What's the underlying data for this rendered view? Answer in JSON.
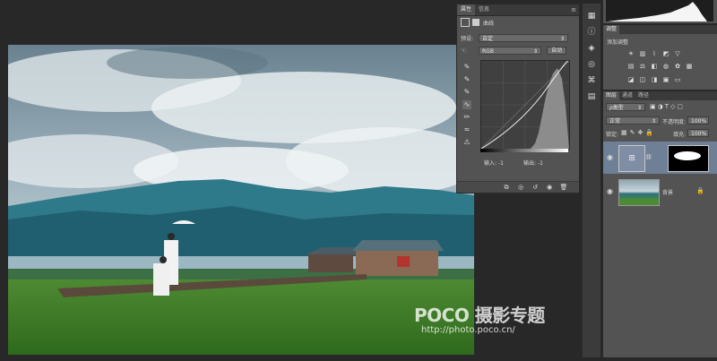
{
  "watermark": {
    "logo": "POCO 摄影专题",
    "url": "http://photo.poco.cn/"
  },
  "properties": {
    "tabs": [
      "属性",
      "信息"
    ],
    "panel_title": "曲线",
    "preset_label": "预设:",
    "preset_value": "自定",
    "channel_value": "RGB",
    "auto_button": "自动",
    "input_label": "输入: -1",
    "output_label": "输出: -1"
  },
  "adjustments": {
    "tabs": [
      "调整"
    ],
    "title": "添加调整"
  },
  "layers": {
    "tabs": [
      "图层",
      "通道",
      "路径"
    ],
    "filter_value": "ρ类型",
    "blend_mode": "正常",
    "opacity_label": "不透明度:",
    "opacity_value": "100%",
    "lock_label": "锁定:",
    "fill_label": "填充:",
    "fill_value": "100%",
    "items": [
      {
        "name": ""
      },
      {
        "name": "背景"
      }
    ]
  },
  "colors": {
    "panel": "#535353",
    "dark": "#282828",
    "selected_layer": "#6e7f96"
  }
}
